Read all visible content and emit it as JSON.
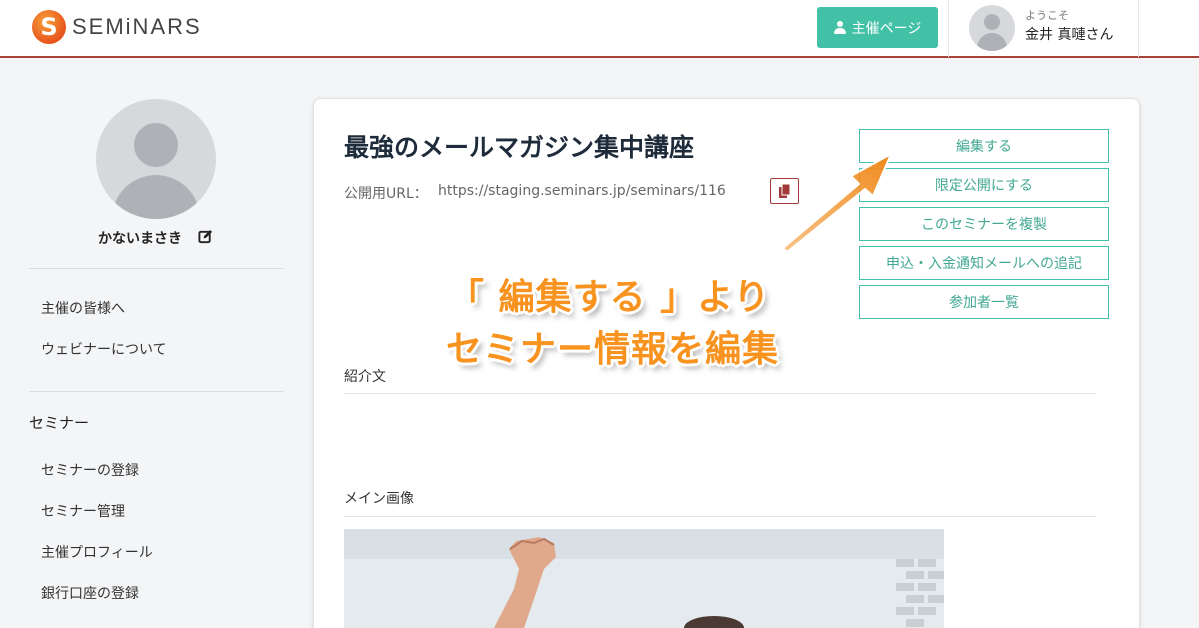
{
  "header": {
    "logo_letter": "S",
    "logo_text": "SEMiNARS",
    "host_page_button": "主催ページ",
    "welcome": "ようこそ",
    "user_name": "金井 真嗹さん"
  },
  "sidebar": {
    "profile_name": "かないまさき",
    "links_group1": [
      "主催の皆様へ",
      "ウェビナーについて"
    ],
    "section_heading": "セミナー",
    "links_group2": [
      "セミナーの登録",
      "セミナー管理",
      "主催プロフィール",
      "銀行口座の登録"
    ]
  },
  "main": {
    "title": "最強のメールマガジン集中講座",
    "url_label": "公開用URL：",
    "url_value": "https://staging.seminars.jp/seminars/116",
    "actions": [
      "編集する",
      "限定公開にする",
      "このセミナーを複製",
      "申込・入金通知メールへの追記",
      "参加者一覧"
    ],
    "intro_label": "紹介文",
    "main_image_label": "メイン画像"
  },
  "annotation": {
    "line1": "「 編集する 」より",
    "line2": "セミナー情報を編集"
  },
  "colors": {
    "accent": "#43c1a7",
    "header_border": "#a9413b",
    "annotation": "#f7931e"
  }
}
